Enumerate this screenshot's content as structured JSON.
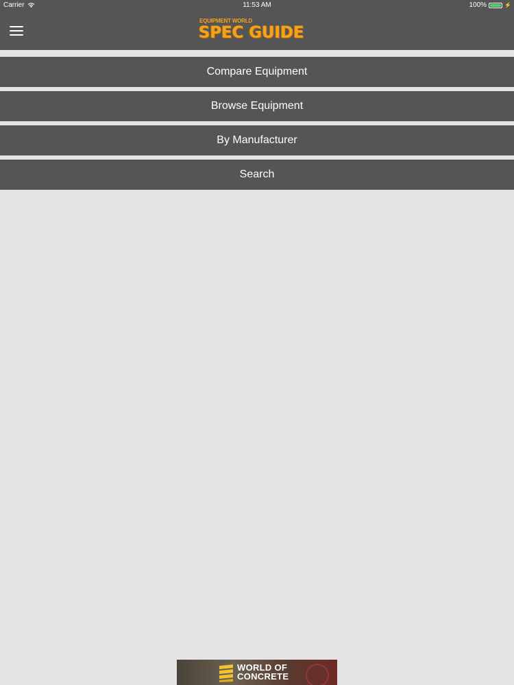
{
  "status_bar": {
    "carrier": "Carrier",
    "time": "11:53 AM",
    "battery_percent": "100%",
    "battery_level": 1.0,
    "wifi_icon": "wifi-icon",
    "battery_icon": "battery-icon",
    "charging_icon": "bolt-icon"
  },
  "header": {
    "menu_icon": "hamburger-menu-icon",
    "logo_top": "EQUIPMENT WORLD",
    "logo_main": "SPEC GUIDE"
  },
  "menu": {
    "items": [
      {
        "label": "Compare Equipment"
      },
      {
        "label": "Browse Equipment"
      },
      {
        "label": "By Manufacturer"
      },
      {
        "label": "Search"
      }
    ]
  },
  "ad": {
    "line1": "WORLD OF",
    "line2": "CONCRETE"
  },
  "colors": {
    "header_bg": "#555556",
    "page_bg": "#e4e3e5",
    "logo_orange": "#f6a31c",
    "battery_green": "#4cd964"
  }
}
